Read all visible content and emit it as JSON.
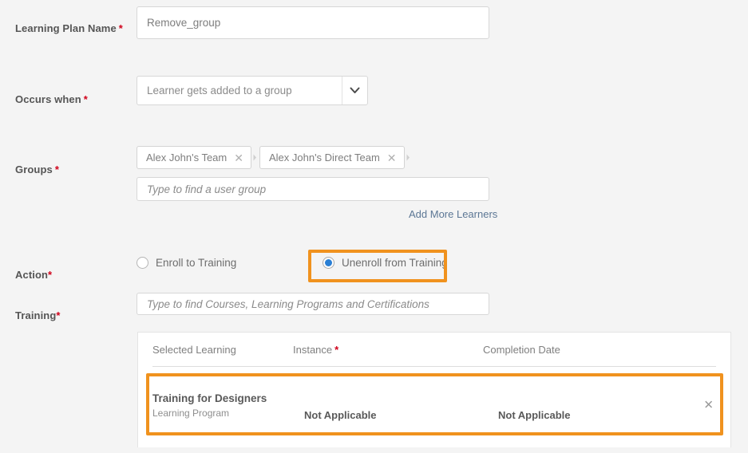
{
  "form": {
    "plan_name": {
      "label": "Learning Plan Name",
      "required_marker": "*",
      "value": "Remove_group"
    },
    "occurs_when": {
      "label": "Occurs when",
      "required_marker": "*",
      "selected": "Learner gets added to a group",
      "chevron_icon": "chevron-down-icon"
    },
    "groups": {
      "label": "Groups",
      "required_marker": "*",
      "chips": [
        {
          "label": "Alex John's Team",
          "remove_icon": "close-icon"
        },
        {
          "label": "Alex John's Direct Team",
          "remove_icon": "close-icon"
        }
      ],
      "search_placeholder": "Type to find a user group",
      "search_value": "",
      "add_more_link": "Add More Learners"
    },
    "action": {
      "label": "Action",
      "required_marker": "*",
      "options": [
        {
          "label": "Enroll to Training",
          "selected": false
        },
        {
          "label": "Unenroll from Training",
          "selected": true
        }
      ],
      "highlight_color": "#f0921e",
      "selected_dot_color": "#2a7fd4"
    },
    "training": {
      "label": "Training",
      "required_marker": "*",
      "search_placeholder": "Type to find Courses, Learning Programs and Certifications",
      "search_value": ""
    }
  },
  "table": {
    "columns": [
      {
        "label": "Selected Learning",
        "required_marker": ""
      },
      {
        "label": "Instance",
        "required_marker": "*"
      },
      {
        "label": "Completion Date",
        "required_marker": ""
      }
    ],
    "rows": [
      {
        "title": "Training for Designers",
        "subtitle": "Learning Program",
        "instance": "Not Applicable",
        "completion_date": "Not Applicable",
        "remove_icon": "close-icon",
        "highlighted": true
      }
    ],
    "highlight_color": "#f0921e"
  }
}
